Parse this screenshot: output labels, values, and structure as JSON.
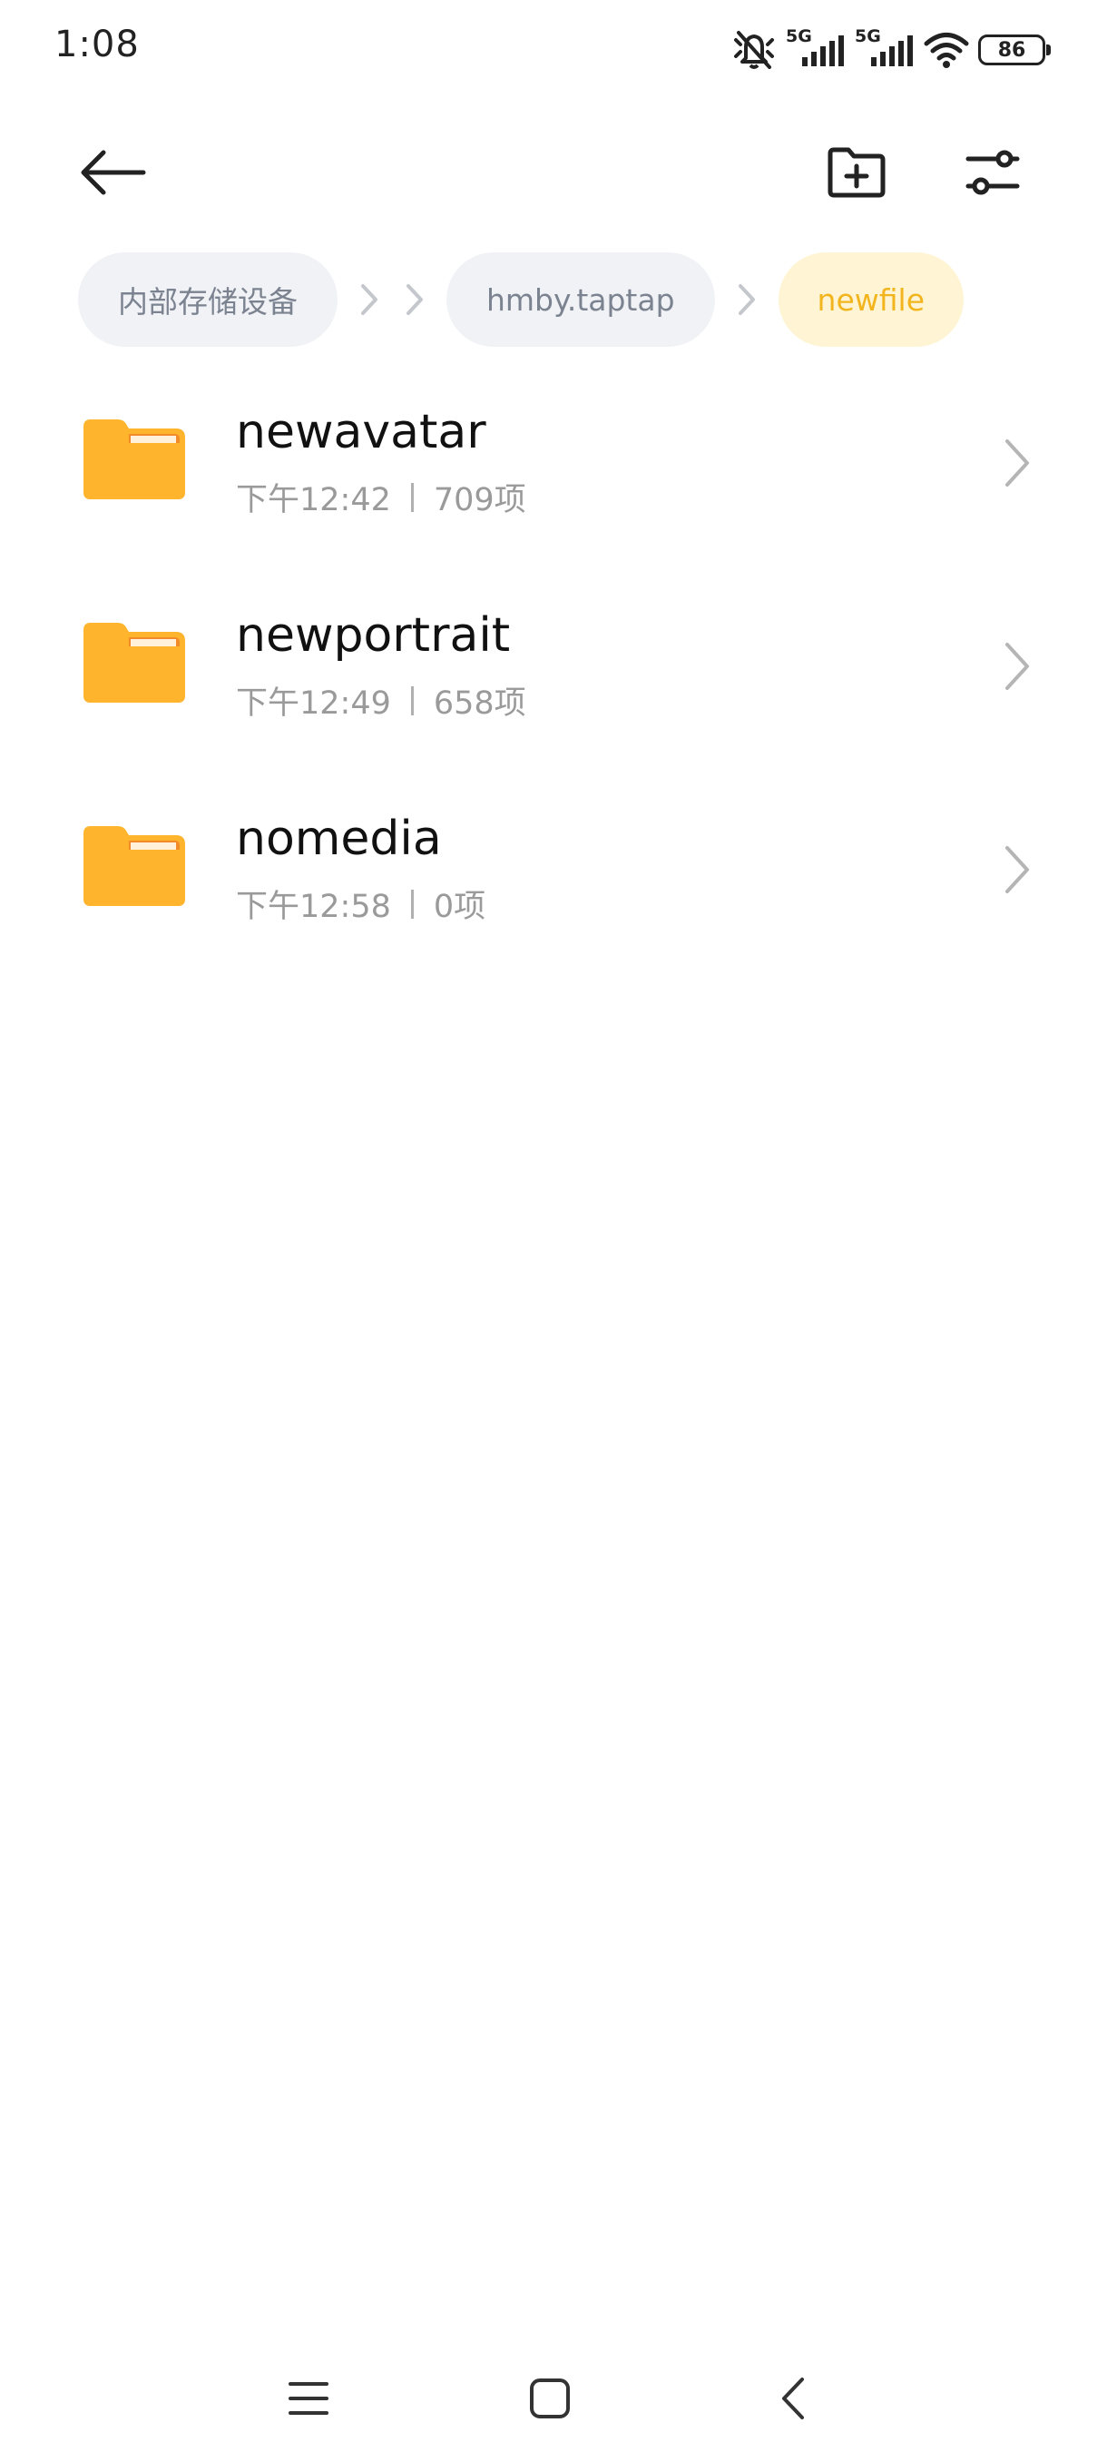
{
  "status_bar": {
    "time": "1:08",
    "network_1": "5G",
    "network_2": "5G",
    "battery": "86",
    "icons": [
      "mute-icon",
      "signal-icon",
      "signal-icon",
      "wifi-icon",
      "battery-icon"
    ]
  },
  "toolbar": {
    "back_icon": "arrow-left-icon",
    "new_folder_icon": "folder-plus-icon",
    "filter_icon": "sliders-icon"
  },
  "breadcrumb": {
    "items": [
      {
        "label": "内部存储设备"
      },
      {
        "label": "hmby.taptap"
      },
      {
        "label": "newfile"
      }
    ]
  },
  "files": [
    {
      "name": "newavatar",
      "time": "下午12:42",
      "count": "709项"
    },
    {
      "name": "newportrait",
      "time": "下午12:49",
      "count": "658项"
    },
    {
      "name": "nomedia",
      "time": "下午12:58",
      "count": "0项"
    }
  ],
  "colors": {
    "folder": "#FFB42E",
    "active_crumb_bg": "#FFF5D5",
    "active_crumb_text": "#F3B51E",
    "crumb_bg": "#F0F2F6",
    "crumb_text": "#7C8390"
  }
}
